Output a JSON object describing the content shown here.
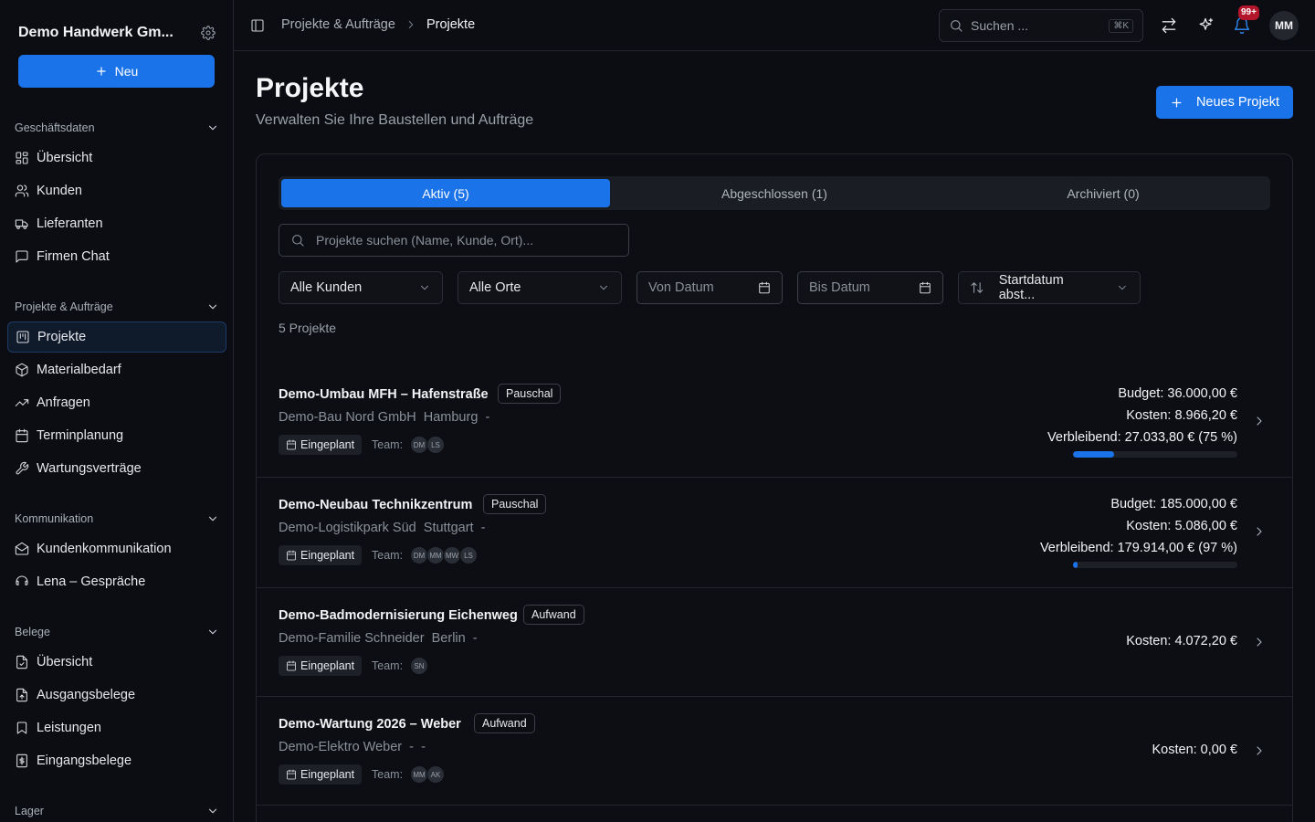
{
  "sidebar": {
    "org_name": "Demo Handwerk Gm...",
    "new_label": "Neu",
    "sections": [
      {
        "title": "Geschäftsdaten",
        "items": [
          {
            "label": "Übersicht",
            "icon": "grid-icon"
          },
          {
            "label": "Kunden",
            "icon": "users-icon"
          },
          {
            "label": "Lieferanten",
            "icon": "truck-icon"
          },
          {
            "label": "Firmen Chat",
            "icon": "chat-icon"
          }
        ]
      },
      {
        "title": "Projekte & Aufträge",
        "items": [
          {
            "label": "Projekte",
            "icon": "kanban-icon",
            "active": true
          },
          {
            "label": "Materialbedarf",
            "icon": "package-icon"
          },
          {
            "label": "Anfragen",
            "icon": "trending-icon"
          },
          {
            "label": "Terminplanung",
            "icon": "calendar-icon"
          },
          {
            "label": "Wartungsverträge",
            "icon": "wrench-icon"
          }
        ]
      },
      {
        "title": "Kommunikation",
        "items": [
          {
            "label": "Kundenkommunikation",
            "icon": "mail-icon"
          },
          {
            "label": "Lena – Gespräche",
            "icon": "headset-icon"
          }
        ]
      },
      {
        "title": "Belege",
        "items": [
          {
            "label": "Übersicht",
            "icon": "file-icon"
          },
          {
            "label": "Ausgangsbelege",
            "icon": "file-out-icon"
          },
          {
            "label": "Leistungen",
            "icon": "bookmark-icon"
          },
          {
            "label": "Eingangsbelege",
            "icon": "receipt-icon"
          }
        ]
      },
      {
        "title": "Lager",
        "items": []
      }
    ]
  },
  "topbar": {
    "crumb_1": "Projekte & Aufträge",
    "crumb_2": "Projekte",
    "search_placeholder": "Suchen ...",
    "search_shortcut": "⌘K",
    "notification_count": "99+",
    "user_initials": "MM"
  },
  "header": {
    "title": "Projekte",
    "subtitle": "Verwalten Sie Ihre Baustellen und Aufträge",
    "new_project_label": "Neues Projekt"
  },
  "tabs": [
    {
      "label": "Aktiv (5)",
      "active": true
    },
    {
      "label": "Abgeschlossen (1)",
      "active": false
    },
    {
      "label": "Archiviert (0)",
      "active": false
    }
  ],
  "filters": {
    "search_placeholder": "Projekte suchen (Name, Kunde, Ort)...",
    "customers": "Alle Kunden",
    "locations": "Alle Orte",
    "from_date": "Von Datum",
    "to_date": "Bis Datum",
    "sort": "Startdatum abst..."
  },
  "project_count": "5 Projekte",
  "team_label": "Team:",
  "projects": [
    {
      "name": "Demo-Umbau MFH – Hafenstraße",
      "billing": "Pauschal",
      "customer": "Demo-Bau Nord GmbH",
      "city": "Hamburg",
      "extra": "-",
      "status": "Eingeplant",
      "team": [
        "DM",
        "LS"
      ],
      "budget": "Budget: 36.000,00 €",
      "costs": "Kosten: 8.966,20 €",
      "remaining": "Verbleibend: 27.033,80 € (75 %)",
      "progress": 0.25
    },
    {
      "name": "Demo-Neubau Technikzentrum",
      "billing": "Pauschal",
      "customer": "Demo-Logistikpark Süd",
      "city": "Stuttgart",
      "extra": "-",
      "status": "Eingeplant",
      "team": [
        "DM",
        "MM",
        "MW",
        "LS"
      ],
      "budget": "Budget: 185.000,00 €",
      "costs": "Kosten: 5.086,00 €",
      "remaining": "Verbleibend: 179.914,00 € (97 %)",
      "progress": 0.03
    },
    {
      "name": "Demo-Badmodernisierung Eichenweg",
      "billing": "Aufwand",
      "customer": "Demo-Familie Schneider",
      "city": "Berlin",
      "extra": "-",
      "status": "Eingeplant",
      "team": [
        "SN"
      ],
      "costs": "Kosten: 4.072,20 €"
    },
    {
      "name": "Demo-Wartung 2026 – Weber",
      "billing": "Aufwand",
      "customer": "Demo-Elektro Weber",
      "city": "-",
      "extra": "-",
      "status": "Eingeplant",
      "team": [
        "MM",
        "AK"
      ],
      "costs": "Kosten: 0,00 €"
    }
  ],
  "colors": {
    "accent": "#1a73e8",
    "badge": "#b3162b",
    "background": "#0b0d12"
  }
}
